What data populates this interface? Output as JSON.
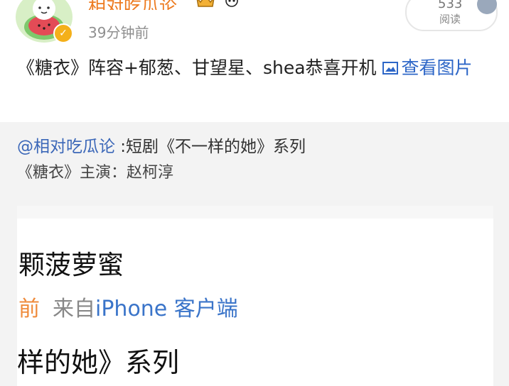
{
  "post": {
    "username": "相对吃瓜论",
    "timestamp": "39分钟前",
    "read_count": "533",
    "read_label": "阅读",
    "text": "《糖衣》阵容+郁葱、甘望星、shea恭喜开机",
    "view_image_link": "查看图片"
  },
  "quoted": {
    "mention": "@相对吃瓜论",
    "text": " :短剧《不一样的她》系列",
    "line2": "《糖衣》主演：赵柯淳"
  },
  "card": {
    "name": "颗菠萝蜜",
    "time_fragment": "前",
    "source_prefix": "来自",
    "source_client": "iPhone 客户端",
    "series_text": "样的她》系列"
  },
  "colors": {
    "username": "#ed7b20",
    "link": "#2d66c7",
    "mention": "#3b67b8",
    "source_client": "#3a74c9"
  }
}
